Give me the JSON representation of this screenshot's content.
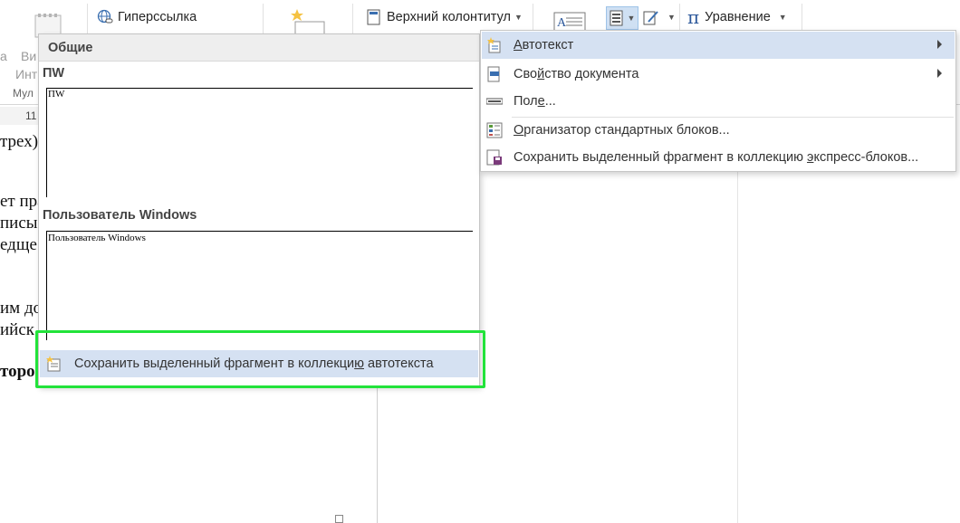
{
  "ribbon": {
    "video_label_1": "Ви",
    "video_label_2": "Инт",
    "group_label": "Мул",
    "hyperlink": "Гиперссылка",
    "header": "Верхний колонтитул",
    "equation": "Уравнение",
    "left_partial": "а",
    "ruler_value": "11"
  },
  "document": {
    "frag1": "трех)",
    "frag2": "ет пра",
    "frag3": "писы",
    "frag4": "едще",
    "frag5": "им до",
    "frag6": "ийск",
    "frag7": "торо"
  },
  "gallery": {
    "header": "Общие",
    "entries": [
      {
        "title": "ПW",
        "preview": "ПW"
      },
      {
        "title": "Пользователь Windows",
        "preview": "Пользователь Windows"
      }
    ],
    "save_pre": "Сохранить выделенный фрагмент в коллекци",
    "save_u": "ю",
    "save_post": " автотекста"
  },
  "menu": {
    "items": [
      {
        "pre": "",
        "u": "А",
        "post": "втотекст"
      },
      {
        "pre": "Сво",
        "u": "й",
        "post": "ство документа"
      },
      {
        "pre": "Пол",
        "u": "е",
        "post": "..."
      },
      {
        "pre": "",
        "u": "О",
        "post": "рганизатор стандартных блоков..."
      },
      {
        "pre": "Сохранить выделенный фрагмент в коллекцию ",
        "u": "э",
        "post": "кспресс-блоков..."
      }
    ]
  },
  "colors": {
    "highlight": "#22e33a",
    "menu_hover": "#d5e1f2",
    "equation_blue": "#2b579a"
  }
}
